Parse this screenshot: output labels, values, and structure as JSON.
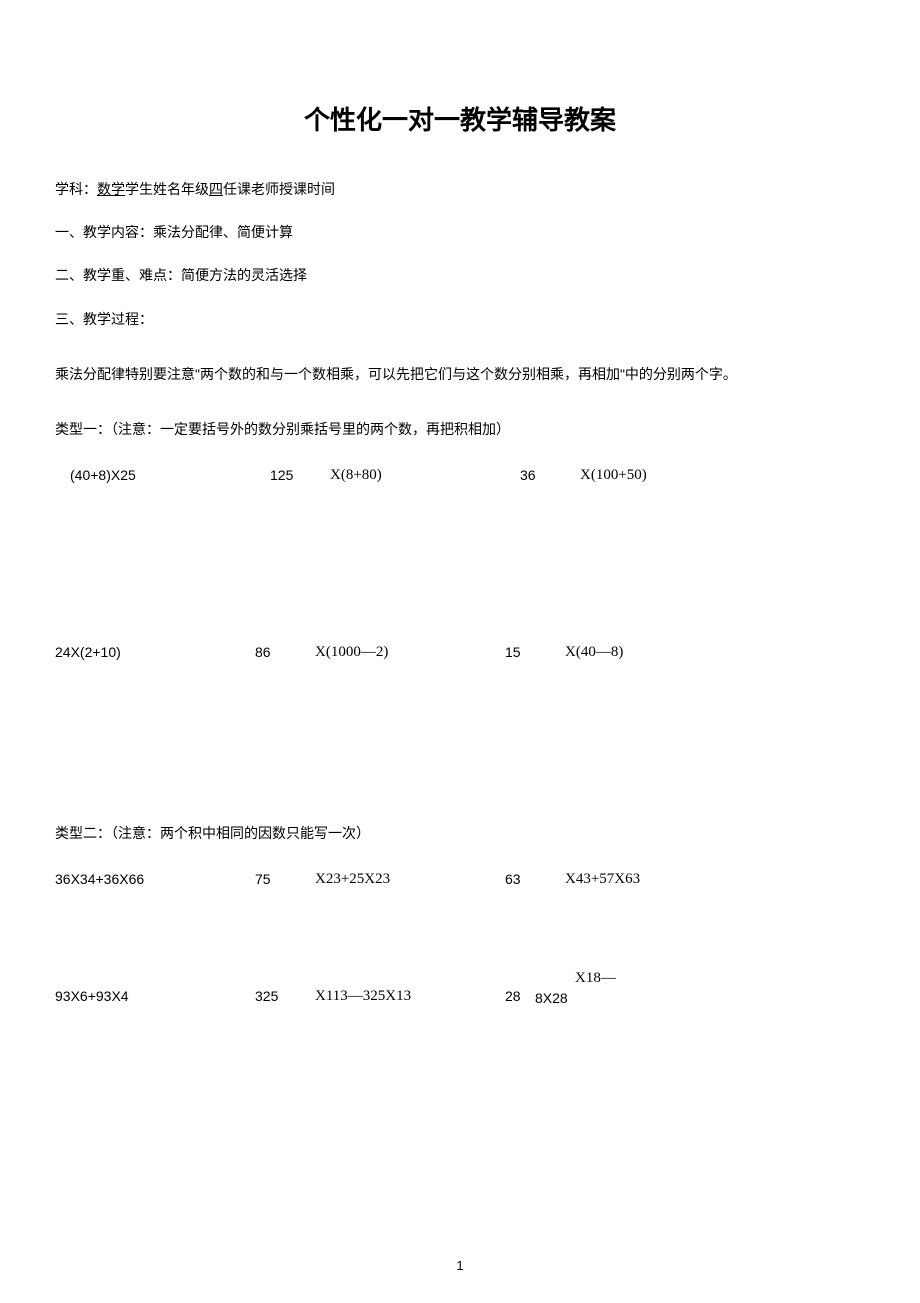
{
  "title": "个性化一对一教学辅导教案",
  "header_line_prefix": "学科：",
  "header_subject": "数学",
  "header_line_suffix": "学生姓名年级",
  "header_grade": "四",
  "header_line_end": "任课老师授课时间",
  "section1": "一、教学内容：乘法分配律、简便计算",
  "section2": "二、教学重、难点：简便方法的灵活选择",
  "section3": "三、教学过程：",
  "intro": "乘法分配律特别要注意\"两个数的和与一个数相乘，可以先把它们与这个数分别相乘，再相加\"中的分别两个字。",
  "type1_label": "类型一：（注意：一定要括号外的数分别乘括号里的两个数，再把积相加）",
  "type2_label": "类型二：（注意：两个积中相同的因数只能写一次）",
  "rows": {
    "r1": {
      "c1": "(40+8)X25",
      "c2a": "125",
      "c2b": "X(8+80)",
      "c3a": "36",
      "c3b": "X(100+50)"
    },
    "r2": {
      "c1": "24X(2+10)",
      "c2a": "86",
      "c2b": "X(1000—2)",
      "c3a": "15",
      "c3b": "X(40—8)"
    },
    "r3": {
      "c1": "36X34+36X66",
      "c2a": "75",
      "c2b": "X23+25X23",
      "c3a": "63",
      "c3b": "X43+57X63"
    },
    "r4": {
      "c1": "93X6+93X4",
      "c2a": "325",
      "c2b": "X113—325X13",
      "c3a": "28",
      "c3top": "X18—",
      "c3bot": "8X28"
    }
  },
  "page_number": "1"
}
